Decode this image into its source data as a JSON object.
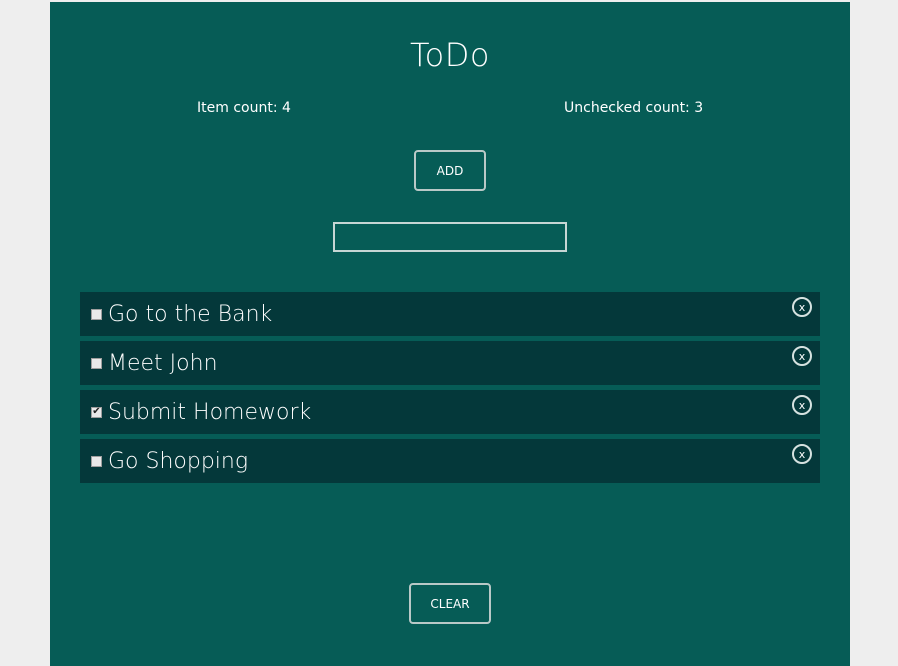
{
  "app": {
    "title": "ToDo"
  },
  "counts": {
    "item_count": "Item count: 4",
    "unchecked_count": "Unchecked count: 3"
  },
  "controls": {
    "add_label": "ADD",
    "input_value": "",
    "clear_label": "CLEAR"
  },
  "todos": [
    {
      "text": "Go to the Bank",
      "checked": false,
      "remove": "x"
    },
    {
      "text": "Meet John",
      "checked": false,
      "remove": "x"
    },
    {
      "text": "Submit Homework",
      "checked": true,
      "remove": "x"
    },
    {
      "text": "Go Shopping",
      "checked": false,
      "remove": "x"
    }
  ]
}
